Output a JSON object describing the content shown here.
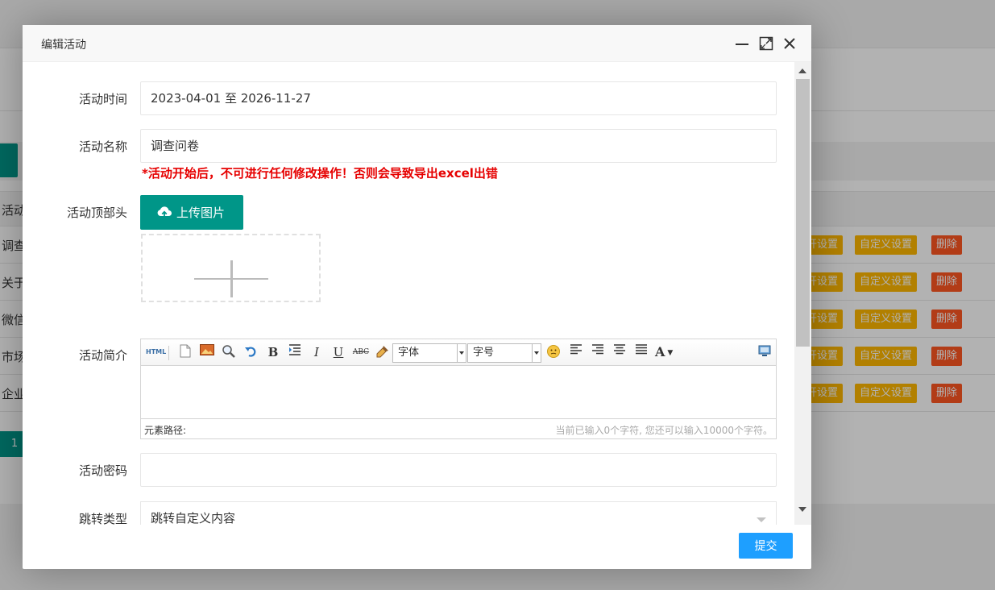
{
  "background": {
    "table_header": "活动",
    "rows": [
      {
        "name": "调查",
        "btn1": "开设置",
        "btn2": "自定义设置",
        "btn3": "删除"
      },
      {
        "name": "关于",
        "btn1": "开设置",
        "btn2": "自定义设置",
        "btn3": "删除"
      },
      {
        "name": "微信",
        "btn1": "开设置",
        "btn2": "自定义设置",
        "btn3": "删除"
      },
      {
        "name": "市场",
        "btn1": "开设置",
        "btn2": "自定义设置",
        "btn3": "删除"
      },
      {
        "name": "企业",
        "btn1": "开设置",
        "btn2": "自定义设置",
        "btn3": "删除"
      }
    ],
    "pager_current": "1"
  },
  "dialog": {
    "title": "编辑活动",
    "fields": {
      "time_label": "活动时间",
      "time_value": "2023-04-01 至 2026-11-27",
      "name_label": "活动名称",
      "name_value": "调查问卷",
      "warning": "*活动开始后，不可进行任何修改操作！否则会导致导出excel出错",
      "header_label": "活动顶部头",
      "upload_label": "上传图片",
      "intro_label": "活动简介",
      "password_label": "活动密码",
      "password_value": "",
      "jump_label": "跳转类型",
      "jump_value": "跳转自定义内容"
    },
    "editor": {
      "font_family": "字体",
      "font_size": "字号",
      "path_label": "元素路径:",
      "char_count": "当前已输入0个字符, 您还可以输入10000个字符。",
      "tools": [
        "html-icon",
        "new-doc-icon",
        "image-icon",
        "find-icon",
        "undo-icon",
        "bold-icon",
        "indent-icon",
        "italic-icon",
        "underline-icon",
        "strikethrough-icon",
        "format-brush-icon",
        "emoticon-icon",
        "align-left-icon",
        "align-right-icon",
        "align-center-icon",
        "justify-icon",
        "font-color-icon",
        "preview-icon"
      ]
    },
    "submit": "提交"
  },
  "colors": {
    "primary_green": "#009688",
    "submit_blue": "#1E9FFF",
    "warning_red": "#e60000",
    "orange": "#FFB800",
    "red": "#FF5722"
  }
}
